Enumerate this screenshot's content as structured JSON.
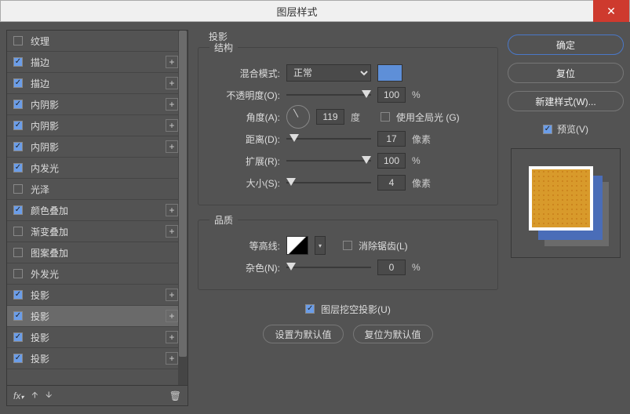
{
  "title": "图层样式",
  "styles": [
    {
      "label": "纹理",
      "checked": false,
      "plus": false
    },
    {
      "label": "描边",
      "checked": true,
      "plus": true
    },
    {
      "label": "描边",
      "checked": true,
      "plus": true
    },
    {
      "label": "内阴影",
      "checked": true,
      "plus": true
    },
    {
      "label": "内阴影",
      "checked": true,
      "plus": true
    },
    {
      "label": "内阴影",
      "checked": true,
      "plus": true
    },
    {
      "label": "内发光",
      "checked": true,
      "plus": false
    },
    {
      "label": "光泽",
      "checked": false,
      "plus": false
    },
    {
      "label": "颜色叠加",
      "checked": true,
      "plus": true
    },
    {
      "label": "渐变叠加",
      "checked": false,
      "plus": true
    },
    {
      "label": "图案叠加",
      "checked": false,
      "plus": false
    },
    {
      "label": "外发光",
      "checked": false,
      "plus": false
    },
    {
      "label": "投影",
      "checked": true,
      "plus": true
    },
    {
      "label": "投影",
      "checked": true,
      "plus": true,
      "selected": true
    },
    {
      "label": "投影",
      "checked": true,
      "plus": true
    },
    {
      "label": "投影",
      "checked": true,
      "plus": true
    }
  ],
  "panel": {
    "name": "投影",
    "section1": "结构",
    "section2": "品质",
    "blend_label": "混合模式:",
    "blend_value": "正常",
    "opacity_label": "不透明度(O):",
    "opacity": "100",
    "pct": "%",
    "angle_label": "角度(A):",
    "angle": "119",
    "deg": "度",
    "global_label": "使用全局光 (G)",
    "distance_label": "距离(D):",
    "distance": "17",
    "px": "像素",
    "spread_label": "扩展(R):",
    "spread": "100",
    "size_label": "大小(S):",
    "size": "4",
    "contour_label": "等高线:",
    "aa_label": "消除锯齿(L)",
    "noise_label": "杂色(N):",
    "noise": "0",
    "knockout_label": "图层挖空投影(U)",
    "set_default": "设置为默认值",
    "reset_default": "复位为默认值"
  },
  "buttons": {
    "ok": "确定",
    "reset": "复位",
    "new_style": "新建样式(W)...",
    "preview": "预览(V)"
  }
}
